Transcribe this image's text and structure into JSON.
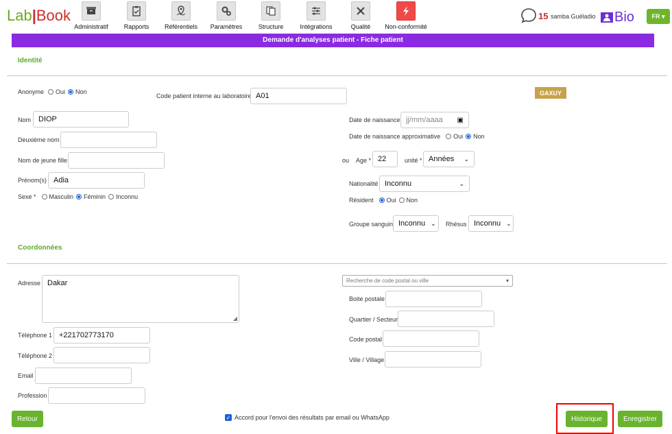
{
  "brand": {
    "lab": "Lab",
    "sep": "|",
    "book": "Book"
  },
  "nav": [
    {
      "label": "Administratif",
      "icon": "archive-icon"
    },
    {
      "label": "Rapports",
      "icon": "clipboard-check-icon"
    },
    {
      "label": "Référentiels",
      "icon": "map-pin-icon"
    },
    {
      "label": "Paramètres",
      "icon": "gears-icon"
    },
    {
      "label": "Structure",
      "icon": "documents-icon"
    },
    {
      "label": "Intégrations",
      "icon": "sliders-icon"
    },
    {
      "label": "Qualité",
      "icon": "tools-icon"
    },
    {
      "label": "Non-conformité",
      "icon": "bolt-icon"
    }
  ],
  "user": {
    "notifications": "15",
    "name": "samba Guéladio",
    "bio": "Bio"
  },
  "lang": "FR",
  "title": "Demande d'analyses patient - Fiche patient",
  "identity": {
    "section": "Identité",
    "anonyme": {
      "label": "Anonyme",
      "oui": "Oui",
      "non": "Non"
    },
    "code_label": "Code patient interne au laboratoire",
    "code_value": "A01",
    "badge": "GAXUY",
    "nom_label": "Nom",
    "nom": "DIOP",
    "deuxieme_label": "Deuxième nom",
    "deuxieme": "",
    "jeune_fille_label": "Nom de jeune fille",
    "jeune_fille": "",
    "prenom_label": "Prénom(s)",
    "prenom": "Adia",
    "sexe": {
      "label": "Sexe *",
      "m": "Masculin",
      "f": "Féminin",
      "i": "Inconnu"
    },
    "dob_label": "Date de naissance",
    "dob_placeholder": "jj/mm/aaaa",
    "dob_approx": {
      "label": "Date de naissance approximative",
      "oui": "Oui",
      "non": "Non"
    },
    "ou": "ou",
    "age_label": "Age *",
    "age": "22",
    "unite_label": "unité *",
    "unite": "Années",
    "nationalite_label": "Nationalité",
    "nationalite": "Inconnu",
    "resident": {
      "label": "Résident",
      "oui": "Oui",
      "non": "Non"
    },
    "groupe_label": "Groupe sanguin",
    "groupe": "Inconnu",
    "rhesus_label": "Rhésus",
    "rhesus": "Inconnu"
  },
  "contact": {
    "section": "Coordonnées",
    "adresse_label": "Adresse",
    "adresse": "Dakar",
    "tel1_label": "Téléphone 1",
    "tel1": "+221702773170",
    "tel2_label": "Téléphone 2",
    "tel2": "",
    "email_label": "Email",
    "email": "",
    "profession_label": "Profession",
    "profession": "",
    "search_placeholder": "Recherche de code postal ou ville",
    "boite_label": "Boite postale",
    "quartier_label": "Quartier / Secteur",
    "cp_label": "Code postal",
    "ville_label": "Ville / Village"
  },
  "footer": {
    "retour": "Retour",
    "consent": "Accord pour l'envoi des résultats par email ou WhatsApp",
    "historique": "Historique",
    "enregistrer": "Enregistrer"
  }
}
